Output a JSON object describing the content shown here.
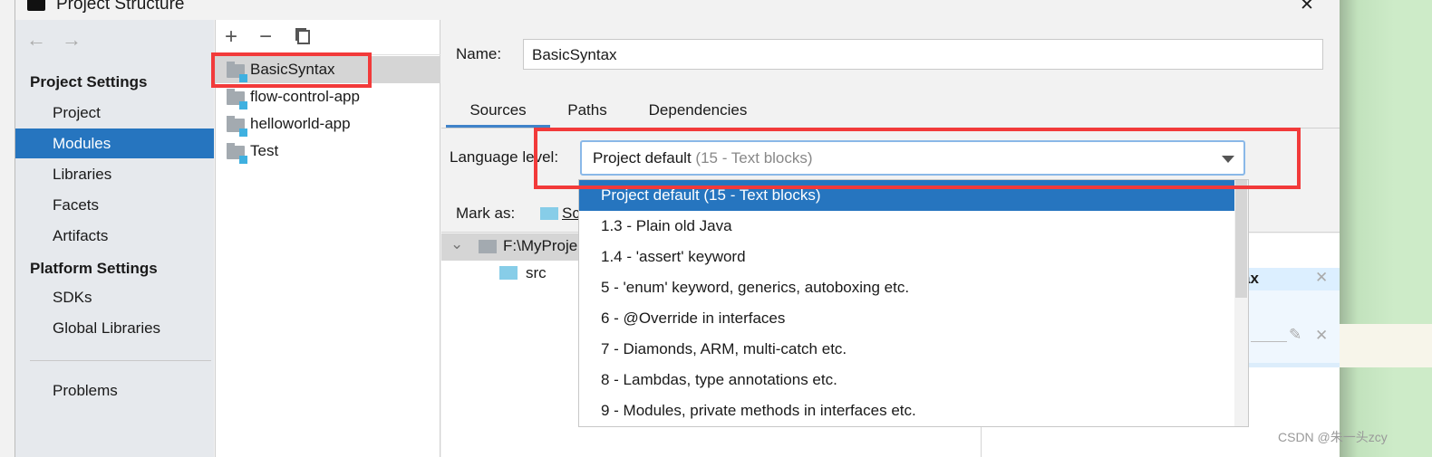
{
  "window": {
    "title": "Project Structure",
    "close": "✕"
  },
  "sidebar": {
    "back": "←",
    "forward": "→",
    "project_settings": "Project Settings",
    "items": [
      {
        "label": "Project"
      },
      {
        "label": "Modules",
        "selected": true
      },
      {
        "label": "Libraries"
      },
      {
        "label": "Facets"
      },
      {
        "label": "Artifacts"
      }
    ],
    "platform_settings": "Platform Settings",
    "platform_items": [
      {
        "label": "SDKs"
      },
      {
        "label": "Global Libraries"
      }
    ],
    "problems": "Problems"
  },
  "modules": {
    "add": "+",
    "remove": "−",
    "copy": "copy-icon",
    "items": [
      {
        "label": "BasicSyntax"
      },
      {
        "label": "flow-control-app"
      },
      {
        "label": "helloworld-app"
      },
      {
        "label": "Test"
      }
    ]
  },
  "detail": {
    "name_label": "Name:",
    "name_value": "BasicSyntax",
    "tabs": [
      {
        "label": "Sources",
        "active": true
      },
      {
        "label": "Paths"
      },
      {
        "label": "Dependencies"
      }
    ],
    "language_level_label": "Language level:",
    "language_level_value": "Project default",
    "language_level_hint": "(15 - Text blocks)",
    "mark_as_label": "Mark as:",
    "mark_as_sources": "Sc",
    "tree_root": "F:\\MyProje",
    "tree_src": "src",
    "right_panel_title": "ax"
  },
  "dropdown": {
    "options": [
      "Project default (15 - Text blocks)",
      "1.3 - Plain old Java",
      "1.4 - 'assert' keyword",
      "5 - 'enum' keyword, generics, autoboxing etc.",
      "6 - @Override in interfaces",
      "7 - Diamonds, ARM, multi-catch etc.",
      "8 - Lambdas, type annotations etc.",
      "9 - Modules, private methods in interfaces etc."
    ],
    "selected_index": 0
  },
  "watermark": "CSDN @朱一头zcy",
  "colors": {
    "selection": "#2675bf",
    "highlight_box": "#f23a3a",
    "folder_badge": "#3fb0e0"
  }
}
